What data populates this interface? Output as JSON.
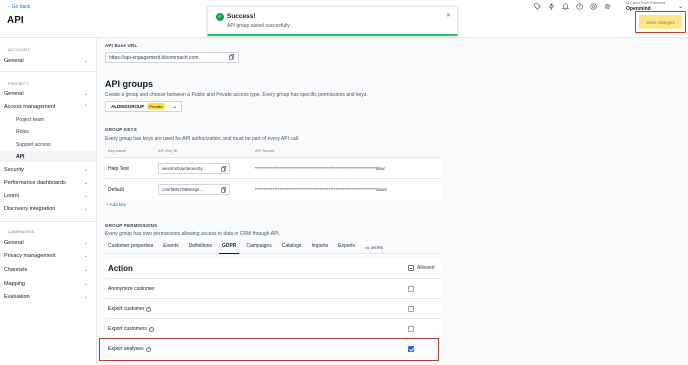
{
  "header": {
    "go_back": "Go back",
    "title": "API",
    "user_subtitle": "QV and Tech Partners",
    "user_name": "Openmind",
    "save_label": "Save changes",
    "icons": [
      "tag-icon",
      "bolt-icon",
      "bell-icon",
      "help-icon",
      "settings-icon",
      "gear-icon"
    ]
  },
  "toast": {
    "title": "Success!",
    "message": "API group saved succesfully"
  },
  "sidebar": {
    "sections": {
      "account": "ACCOUNT",
      "project": "PROJECT",
      "campaigns": "CAMPAIGNS"
    },
    "account_items": [
      {
        "label": "General"
      }
    ],
    "project_items": [
      {
        "label": "General"
      },
      {
        "label": "Access management"
      }
    ],
    "access_sub": [
      {
        "label": "Project team"
      },
      {
        "label": "Roles"
      },
      {
        "label": "Support access"
      },
      {
        "label": "API"
      }
    ],
    "project_items_after": [
      {
        "label": "Security"
      },
      {
        "label": "Performance dashboards"
      },
      {
        "label": "Loomi"
      },
      {
        "label": "Discovery integration"
      }
    ],
    "campaign_items": [
      {
        "label": "General"
      },
      {
        "label": "Privacy management"
      },
      {
        "label": "Channels"
      },
      {
        "label": "Mapping"
      },
      {
        "label": "Evaluation"
      }
    ]
  },
  "main": {
    "api_base_url_label": "API Base URL",
    "api_base_url": "https://api-engagement.bloomreach.com",
    "groups_title": "API groups",
    "groups_desc": "Create a group and choose between a Public and Private access type. Every group has specific permissions and keys.",
    "group_name": "ALDINSGROUP",
    "group_badge": "Private",
    "group_keys_label": "GROUP KEYS",
    "group_keys_desc": "Every group has keys are used for API authorization, and must be part of every API call.",
    "keys_columns": {
      "name": "Key name",
      "id": "API Key ID",
      "secret": "API Secret"
    },
    "keys": [
      {
        "name": "Hiep Test",
        "id": "wexshx0oje3eoex0y...",
        "secret": "*********************************************************************56xc"
      },
      {
        "name": "Default",
        "id": "c3orf9057090e3ge...",
        "secret": "*********************************************************************2wwz"
      }
    ],
    "add_key": "+ Add key",
    "permissions_label": "GROUP PERMISSIONS",
    "permissions_desc": "Every group has own permissions allowing access to data in CRM through API.",
    "tabs": [
      "Customer properties",
      "Events",
      "Definitions",
      "GDPR",
      "Campaigns",
      "Catalogs",
      "Imports",
      "Exports"
    ],
    "active_tab": "GDPR",
    "more_label": "MORE",
    "action_header": "Action",
    "allowed_header": "Allowed",
    "actions": [
      {
        "label": "Anonymize customer",
        "info": false,
        "allowed": false
      },
      {
        "label": "Export customer",
        "info": true,
        "allowed": false
      },
      {
        "label": "Export customers",
        "info": true,
        "allowed": false
      },
      {
        "label": "Export analyses",
        "info": true,
        "allowed": true
      }
    ]
  },
  "colors": {
    "accent": "#2563eb",
    "save_bg": "#fce68a",
    "highlight": "#c0392b",
    "success": "#16a34a"
  }
}
